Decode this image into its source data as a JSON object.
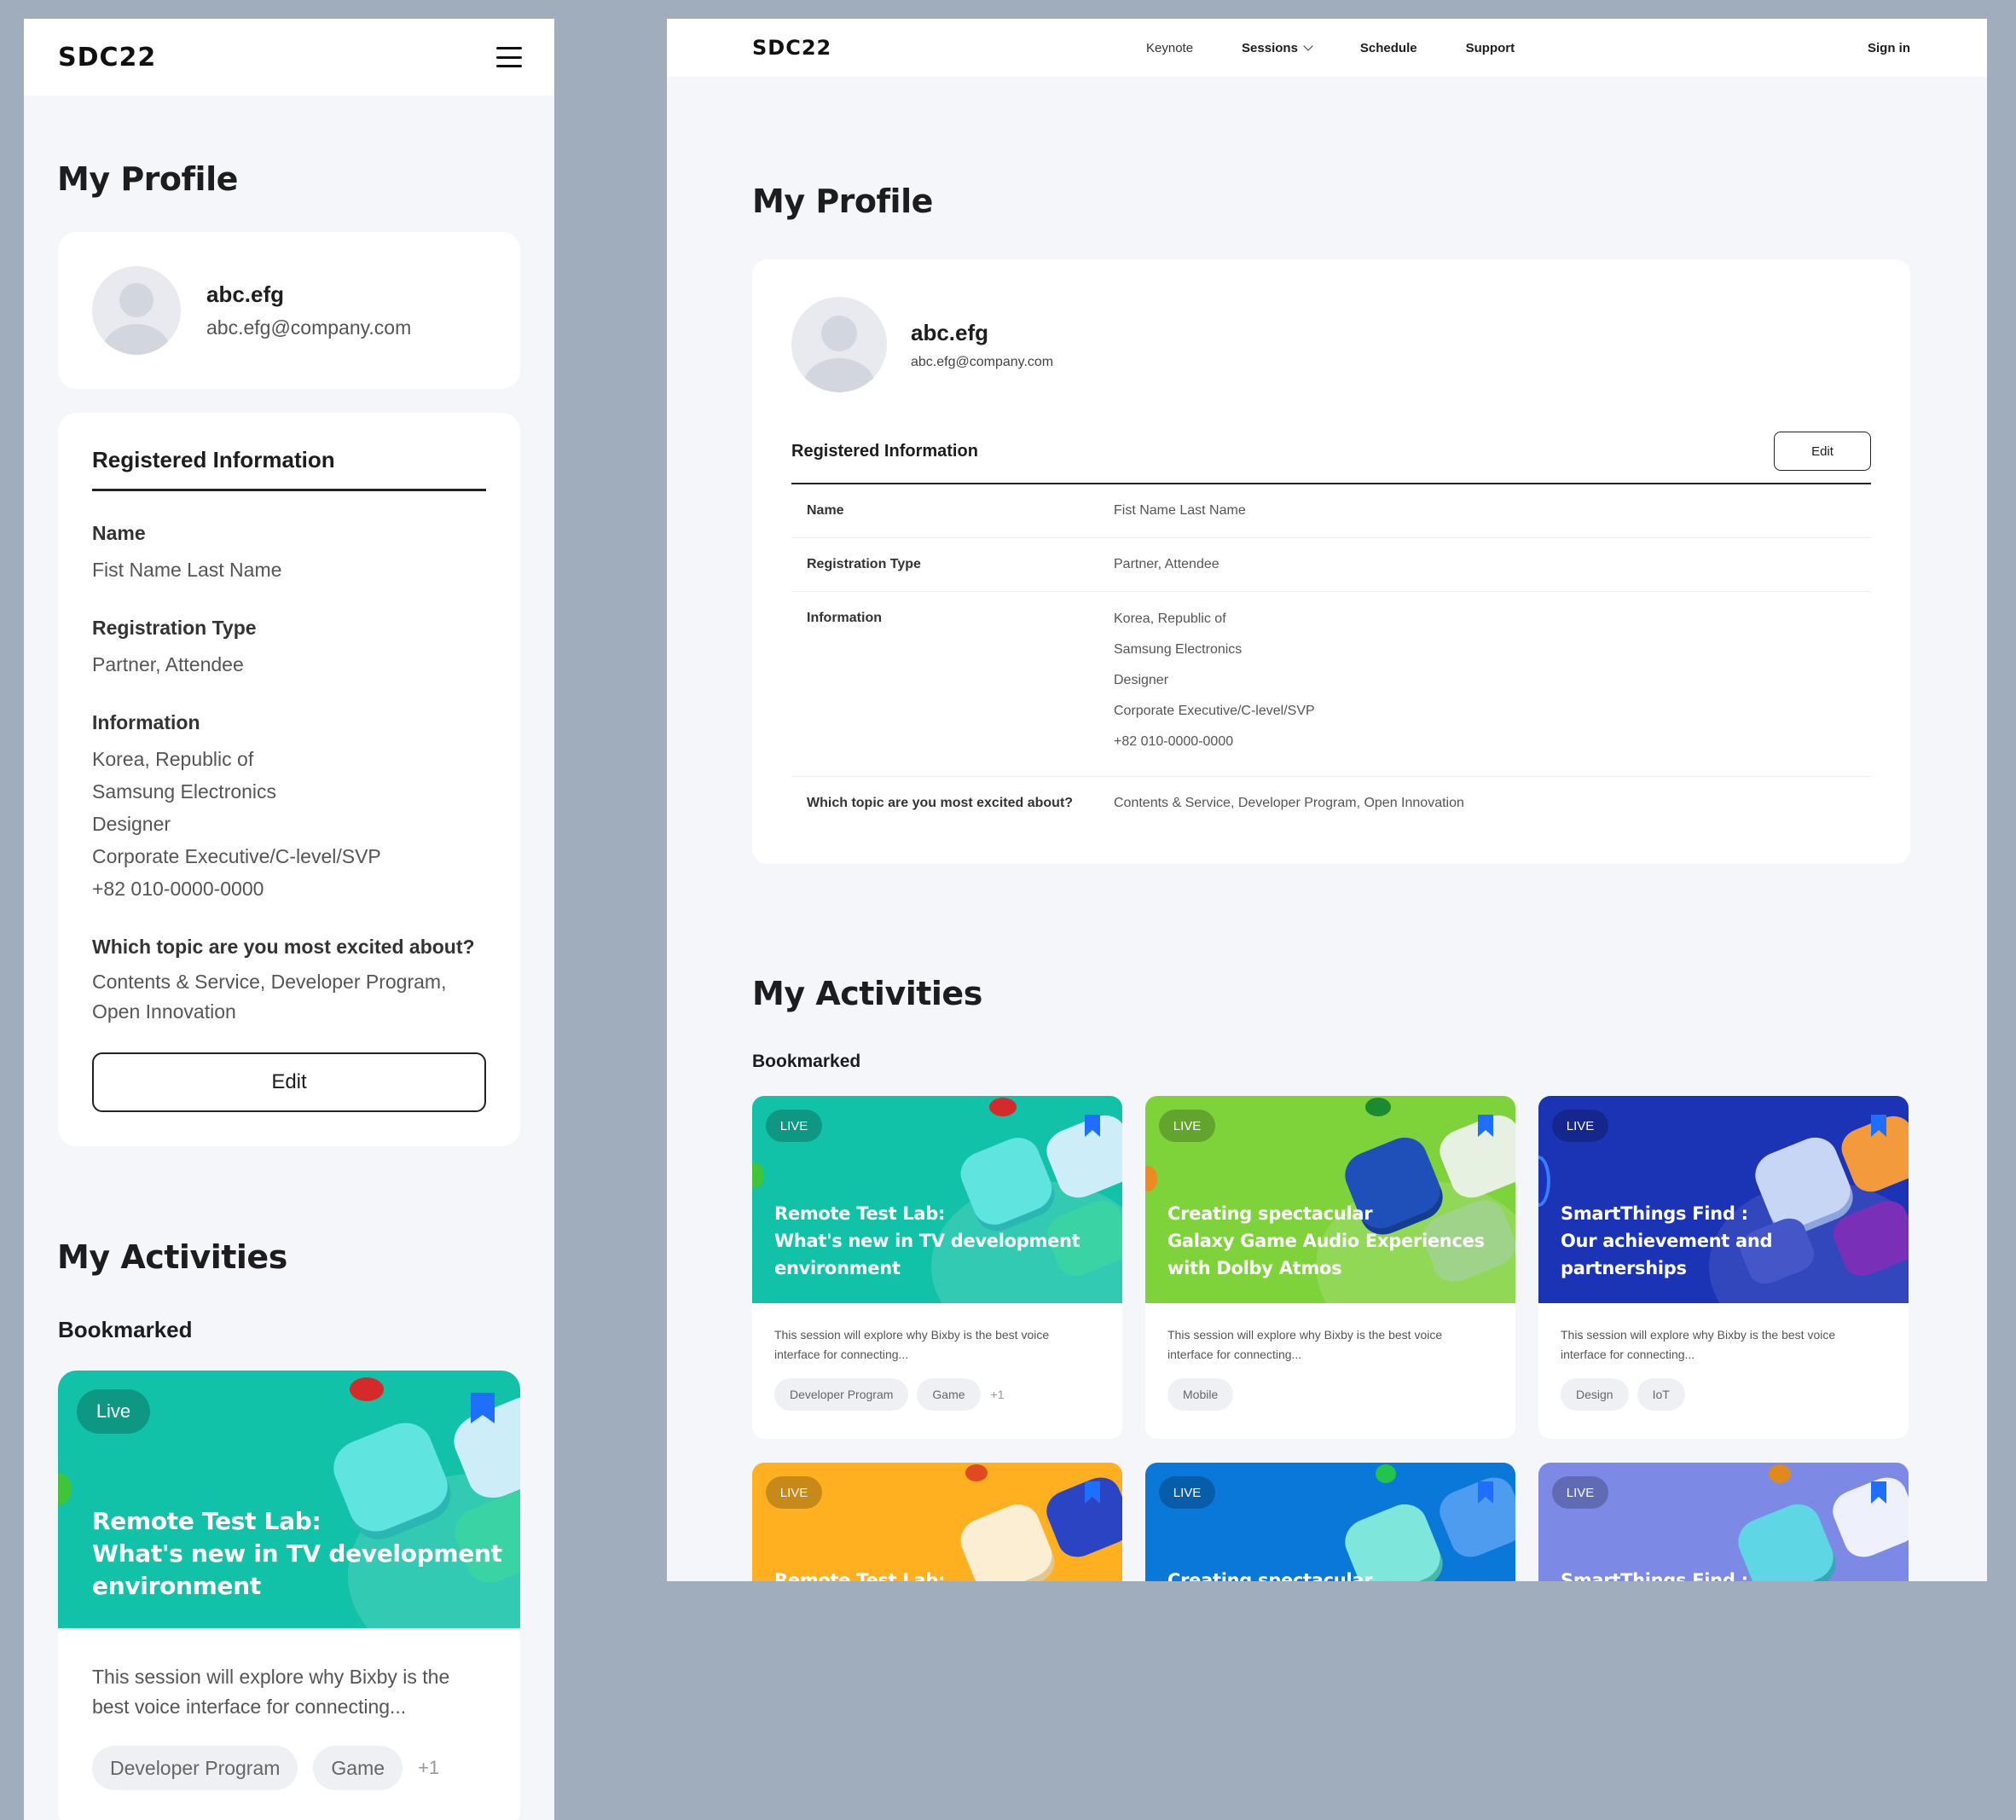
{
  "brand": {
    "logo": "SDC22"
  },
  "nav": {
    "keynote": "Keynote",
    "sessions": "Sessions",
    "schedule": "Schedule",
    "support": "Support",
    "sign_in": "Sign in"
  },
  "profile": {
    "title": "My Profile",
    "username": "abc.efg",
    "email": "abc.efg@company.com"
  },
  "registered": {
    "title": "Registered Information",
    "edit_label": "Edit",
    "name_label": "Name",
    "name_value": "Fist Name Last Name",
    "type_label": "Registration Type",
    "type_value": "Partner, Attendee",
    "info_label": "Information",
    "info_lines": [
      "Korea, Republic of",
      "Samsung Electronics",
      "Designer",
      "Corporate Executive/C-level/SVP",
      "+82 010-0000-0000"
    ],
    "topic_label": "Which topic are you most excited about?",
    "topic_value": "Contents & Service, Developer Program, Open Innovation",
    "topic_value_mobile_line1": "Contents & Service, Developer Program,",
    "topic_value_mobile_line2": "Open Innovation"
  },
  "activities": {
    "title": "My Activities",
    "bookmarked": "Bookmarked"
  },
  "sessions": [
    {
      "badge": "LIVE",
      "title_lines": [
        "Remote Test Lab:",
        "What's new in TV development",
        "environment"
      ],
      "desc_lines": [
        "This session will explore why Bixby is the best voice",
        "interface for connecting..."
      ],
      "tags": [
        "Developer Program",
        "Game"
      ],
      "more": "+1",
      "color": "#12c2a8"
    },
    {
      "badge": "LIVE",
      "title_lines": [
        "Creating spectacular",
        "Galaxy Game Audio Experiences",
        "with Dolby Atmos"
      ],
      "desc_lines": [
        "This session will explore why Bixby is the best voice",
        "interface for connecting..."
      ],
      "tags": [
        "Mobile"
      ],
      "more": "",
      "color": "#7ed23a"
    },
    {
      "badge": "LIVE",
      "title_lines": [
        "SmartThings Find :",
        "Our achievement and",
        "partnerships"
      ],
      "desc_lines": [
        "This session will explore why Bixby is the best voice",
        "interface for connecting..."
      ],
      "tags": [
        "Design",
        "IoT"
      ],
      "more": "",
      "color": "#1b33b5"
    },
    {
      "badge": "LIVE",
      "title_lines": [
        "Remote Test Lab:"
      ],
      "color": "#ffb020"
    },
    {
      "badge": "LIVE",
      "title_lines": [
        "Creating spectacular"
      ],
      "color": "#0a78d8"
    },
    {
      "badge": "LIVE",
      "title_lines": [
        "SmartThings Find :"
      ],
      "color": "#7c8ae6"
    }
  ],
  "mobile_session": {
    "badge": "Live",
    "title_lines": [
      "Remote Test Lab:",
      "What's new in TV development",
      "environment"
    ],
    "desc_lines": [
      "This session will explore why Bixby is the",
      "best voice interface for connecting..."
    ],
    "tags": [
      "Developer Program",
      "Game"
    ],
    "more": "+1"
  },
  "icons": {
    "menu": "hamburger-icon",
    "chevron": "chevron-down-icon",
    "avatar": "user-avatar-icon",
    "bookmark": "bookmark-icon"
  }
}
